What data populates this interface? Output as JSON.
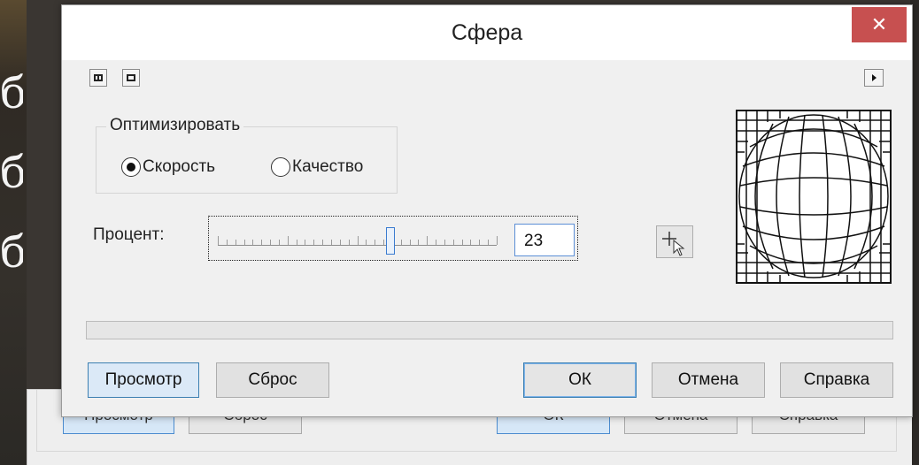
{
  "background_window": {
    "left_glyph": "б\nб\nб",
    "buttons": [
      "Просмотр",
      "Сброс",
      "ОК",
      "Отмена",
      "Справка"
    ]
  },
  "dialog": {
    "title": "Сфера",
    "close_label": "✕",
    "accent_color": "#c75050",
    "optimize": {
      "legend": "Оптимизировать",
      "options": [
        {
          "label": "Скорость",
          "selected": true
        },
        {
          "label": "Качество",
          "selected": false
        }
      ]
    },
    "percent": {
      "label": "Процент:",
      "value": "23",
      "slider_position_fraction": 0.62
    },
    "buttons": {
      "preview": "Просмотр",
      "reset": "Сброс",
      "ok": "ОК",
      "cancel": "Отмена",
      "help": "Справка"
    },
    "icons": {
      "tool1": "split-view-icon",
      "tool2": "single-view-icon",
      "expand": "triangle-right-icon",
      "picker": "crosshair-cursor-icon",
      "close": "close-icon"
    }
  }
}
